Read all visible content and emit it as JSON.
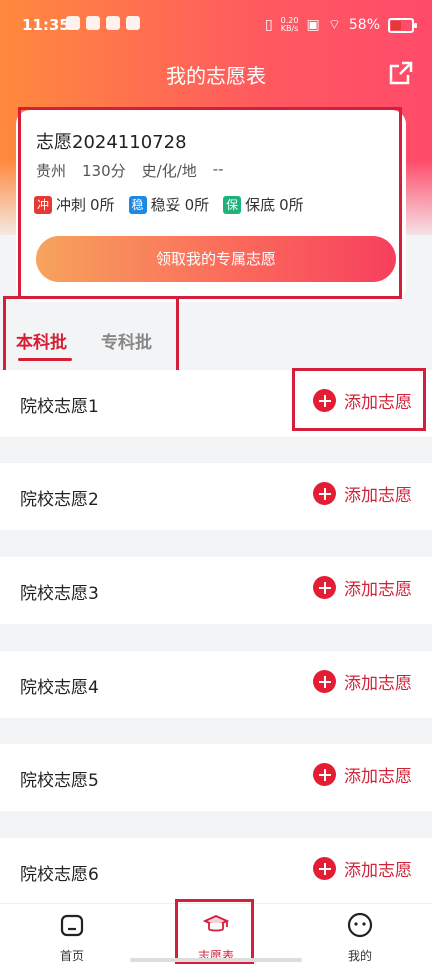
{
  "status_bar": {
    "time": "11:35",
    "net_speed": "0.20",
    "net_unit": "KB/s",
    "battery_pct": "58%"
  },
  "header": {
    "title": "我的志愿表"
  },
  "card": {
    "name": "志愿2024110728",
    "province": "贵州",
    "score": "130分",
    "subjects": "史/化/地",
    "extra": "--",
    "stats": [
      {
        "tag": "冲",
        "label": "冲刺",
        "count": "0所",
        "color": "#e53935"
      },
      {
        "tag": "稳",
        "label": "稳妥",
        "count": "0所",
        "color": "#1e88e5"
      },
      {
        "tag": "保",
        "label": "保底",
        "count": "0所",
        "color": "#1db37a"
      }
    ],
    "cta_label": "领取我的专属志愿"
  },
  "tabs": [
    {
      "label": "本科批",
      "active": true
    },
    {
      "label": "专科批",
      "active": false
    }
  ],
  "rows": [
    {
      "label": "院校志愿1",
      "action": "添加志愿"
    },
    {
      "label": "院校志愿2",
      "action": "添加志愿"
    },
    {
      "label": "院校志愿3",
      "action": "添加志愿"
    },
    {
      "label": "院校志愿4",
      "action": "添加志愿"
    },
    {
      "label": "院校志愿5",
      "action": "添加志愿"
    },
    {
      "label": "院校志愿6",
      "action": "添加志愿"
    }
  ],
  "nav": [
    {
      "label": "首页",
      "icon": "home-icon"
    },
    {
      "label": "志愿表",
      "icon": "graduation-cap-icon"
    },
    {
      "label": "我的",
      "icon": "smile-face-icon"
    }
  ],
  "accent_color": "#d41e3b"
}
